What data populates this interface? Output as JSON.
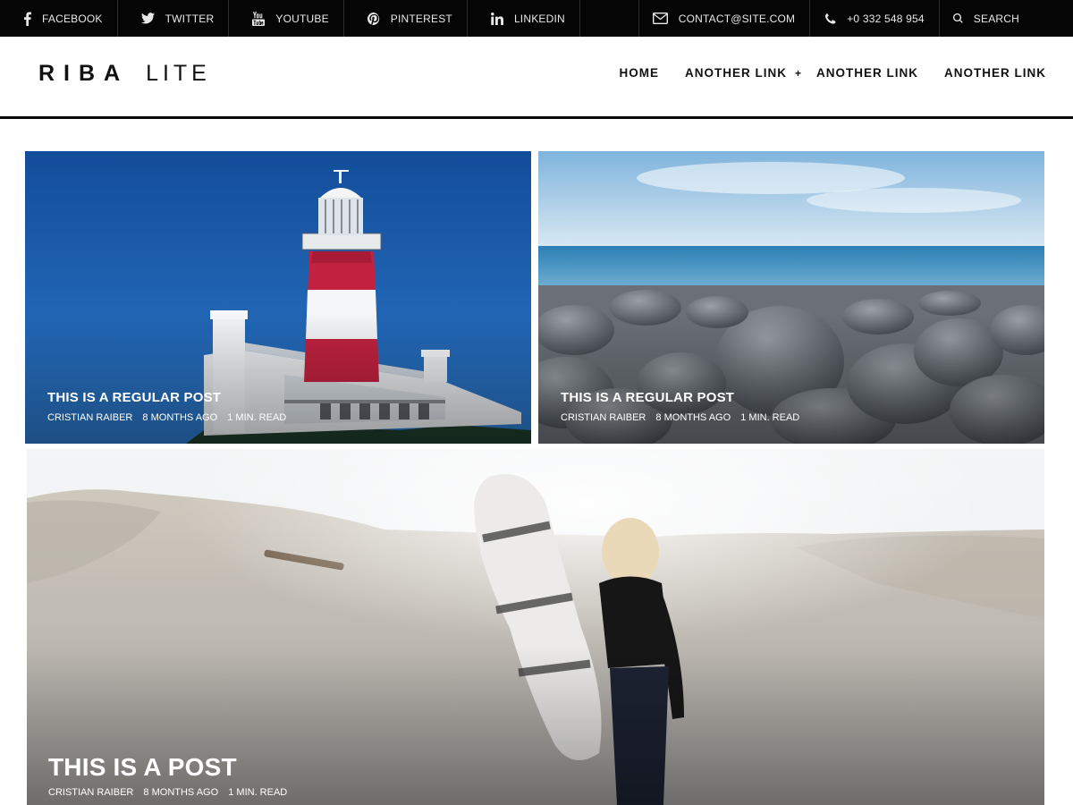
{
  "topbar": {
    "social": [
      {
        "label": "FACEBOOK",
        "icon": "facebook-icon"
      },
      {
        "label": "TWITTER",
        "icon": "twitter-icon"
      },
      {
        "label": "YOUTUBE",
        "icon": "youtube-icon"
      },
      {
        "label": "PINTEREST",
        "icon": "pinterest-icon"
      },
      {
        "label": "LINKEDIN",
        "icon": "linkedin-icon"
      }
    ],
    "email": {
      "label": "CONTACT@SITE.COM",
      "icon": "envelope-icon"
    },
    "phone": {
      "label": "+0 332 548 954",
      "icon": "phone-icon"
    },
    "search": {
      "label": "SEARCH",
      "icon": "search-icon"
    }
  },
  "header": {
    "logo_bold": "RIBA",
    "logo_light": "LITE"
  },
  "nav": {
    "items": [
      "HOME",
      "ANOTHER LINK",
      "ANOTHER LINK",
      "ANOTHER LINK"
    ],
    "submenu_indicator": "+"
  },
  "posts": [
    {
      "title": "THIS IS A REGULAR POST",
      "author": "CRISTIAN RAIBER",
      "date": "8 MONTHS AGO",
      "read": "1 MIN. READ"
    },
    {
      "title": "THIS IS A REGULAR POST",
      "author": "CRISTIAN RAIBER",
      "date": "8 MONTHS AGO",
      "read": "1 MIN. READ"
    },
    {
      "title": "THIS IS A POST",
      "author": "CRISTIAN RAIBER",
      "date": "8 MONTHS AGO",
      "read": "1 MIN. READ"
    }
  ],
  "colors": {
    "topbar_bg": "#050505",
    "header_rule": "#0a0a0a",
    "sky_blue": "#1f5ea8",
    "lighthouse_red": "#c2223f",
    "sea_blue": "#3f8fbf",
    "sand": "#cfc8bd"
  }
}
